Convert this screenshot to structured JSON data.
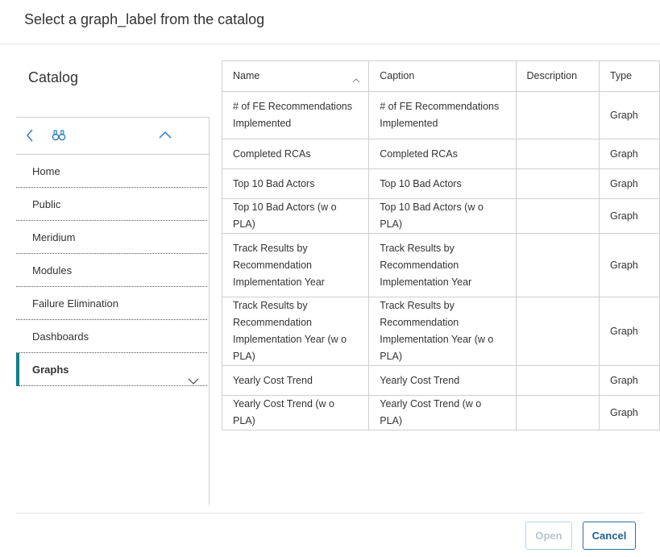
{
  "dialog": {
    "title": "Select a graph_label from the catalog"
  },
  "sidebar": {
    "heading": "Catalog",
    "toolbar": {
      "back_icon": "chevron-left-icon",
      "search_icon": "binoculars-icon",
      "collapse_icon": "chevron-up-icon"
    },
    "items": [
      {
        "label": "Home"
      },
      {
        "label": "Public"
      },
      {
        "label": "Meridium"
      },
      {
        "label": "Modules"
      },
      {
        "label": "Failure Elimination"
      },
      {
        "label": "Dashboards"
      },
      {
        "label": "Graphs",
        "active": true
      }
    ],
    "accent_color": "#0f7f8a"
  },
  "table": {
    "columns": [
      "Name",
      "Caption",
      "Description",
      "Type"
    ],
    "sort_icon": "chevron-up-icon",
    "rows": [
      {
        "name": "# of FE Recommendations Implemented",
        "caption": "# of FE Recommendations Implemented",
        "description": "",
        "type": "Graph"
      },
      {
        "name": "Completed RCAs",
        "caption": "Completed RCAs",
        "description": "",
        "type": "Graph"
      },
      {
        "name": "Top 10 Bad Actors",
        "caption": "Top 10 Bad Actors",
        "description": "",
        "type": "Graph"
      },
      {
        "name": "Top 10 Bad Actors (w o PLA)",
        "caption": "Top 10 Bad Actors (w o PLA)",
        "description": "",
        "type": "Graph"
      },
      {
        "name": "Track Results by Recommendation Implementation Year",
        "caption": "Track Results by Recommendation Implementation Year",
        "description": "",
        "type": "Graph"
      },
      {
        "name": "Track Results by Recommendation Implementation Year (w o PLA)",
        "caption": "Track Results by Recommendation Implementation Year (w o PLA)",
        "description": "",
        "type": "Graph"
      },
      {
        "name": "Yearly Cost Trend",
        "caption": "Yearly Cost Trend",
        "description": "",
        "type": "Graph"
      },
      {
        "name": "Yearly Cost Trend (w o PLA)",
        "caption": "Yearly Cost Trend (w o PLA)",
        "description": "",
        "type": "Graph"
      }
    ]
  },
  "footer": {
    "open_label": "Open",
    "cancel_label": "Cancel"
  }
}
